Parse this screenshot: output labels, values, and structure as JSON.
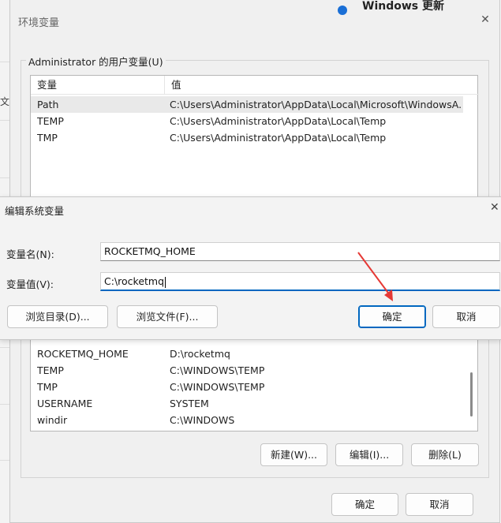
{
  "background": {
    "left_fragment": "文件",
    "update_label": "Windows 更新"
  },
  "env_window": {
    "title": "环境变量",
    "user_group_label": "Administrator 的用户变量(U)",
    "columns": {
      "name": "变量",
      "value": "值"
    },
    "user_vars": [
      {
        "name": "Path",
        "value": "C:\\Users\\Administrator\\AppData\\Local\\Microsoft\\WindowsA..."
      },
      {
        "name": "TEMP",
        "value": "C:\\Users\\Administrator\\AppData\\Local\\Temp"
      },
      {
        "name": "TMP",
        "value": "C:\\Users\\Administrator\\AppData\\Local\\Temp"
      }
    ],
    "system_vars": [
      {
        "name": "ROCKETMQ_HOME",
        "value": "D:\\rocketmq"
      },
      {
        "name": "TEMP",
        "value": "C:\\WINDOWS\\TEMP"
      },
      {
        "name": "TMP",
        "value": "C:\\WINDOWS\\TEMP"
      },
      {
        "name": "USERNAME",
        "value": "SYSTEM"
      },
      {
        "name": "windir",
        "value": "C:\\WINDOWS"
      }
    ],
    "sys_buttons": {
      "new": "新建(W)...",
      "edit": "编辑(I)...",
      "delete": "删除(L)"
    },
    "ok": "确定",
    "cancel": "取消"
  },
  "edit_dialog": {
    "title": "编辑系统变量",
    "name_label": "变量名(N):",
    "name_value": "ROCKETMQ_HOME",
    "value_label": "变量值(V):",
    "value_value": "C:\\rocketmq",
    "browse_dir": "浏览目录(D)...",
    "browse_file": "浏览文件(F)...",
    "ok": "确定",
    "cancel": "取消"
  },
  "colors": {
    "accent": "#0067c0",
    "annotation_arrow": "#e53935"
  }
}
